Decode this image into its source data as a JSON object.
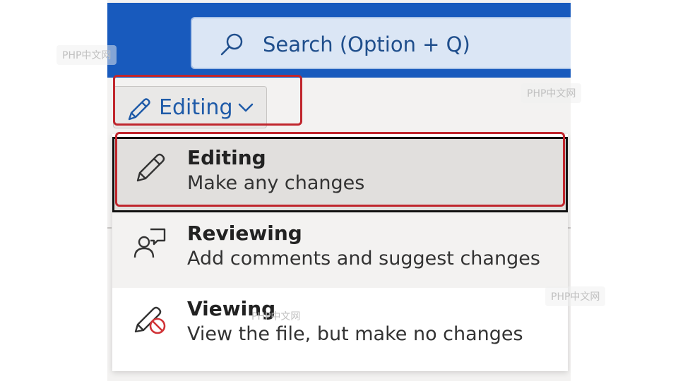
{
  "header": {
    "search_placeholder": "Search (Option + Q)",
    "search_icon": "search-icon",
    "brand_color": "#185abd"
  },
  "mode_button": {
    "label": "Editing",
    "icon": "pencil-icon",
    "chevron": "chevron-down-icon",
    "label_color": "#1e5aa8"
  },
  "mode_menu": {
    "items": [
      {
        "title": "Editing",
        "description": "Make any changes",
        "icon": "pencil-icon",
        "selected": true
      },
      {
        "title": "Reviewing",
        "description": "Add comments and suggest changes",
        "icon": "reviewer-comment-icon",
        "selected": false
      },
      {
        "title": "Viewing",
        "description": "View the file, but make no changes",
        "icon": "no-edit-pencil-icon",
        "selected": false
      }
    ]
  },
  "highlight_color": "#c0262d",
  "watermarks": [
    "PHP中文网",
    "PHP中文网",
    "PHP中文网",
    "PHP中文网"
  ]
}
